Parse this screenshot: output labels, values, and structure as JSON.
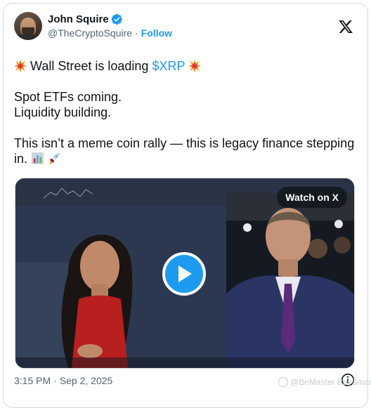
{
  "author": {
    "name": "John Squire",
    "handle": "@TheCryptoSquire",
    "separator": "·",
    "follow_label": "Follow",
    "verified_icon": "verified-badge-icon"
  },
  "tweet": {
    "line1_prefix": "Wall Street is loading ",
    "cashtag": "$XRP",
    "line2": "Spot ETFs coming.",
    "line3": "Liquidity building.",
    "line4": "This isn’t a meme coin rally — this is legacy finance stepping in."
  },
  "media": {
    "watch_label": "Watch on X",
    "play_icon": "play-icon"
  },
  "meta": {
    "time": "3:15 PM",
    "separator": "·",
    "date": "Sep 2, 2025"
  },
  "watermark": {
    "text": "@BeMaster BuySmart"
  },
  "colors": {
    "accent": "#1d9bf0",
    "text": "#0f1419",
    "muted": "#536471",
    "border": "#cfd9de"
  }
}
